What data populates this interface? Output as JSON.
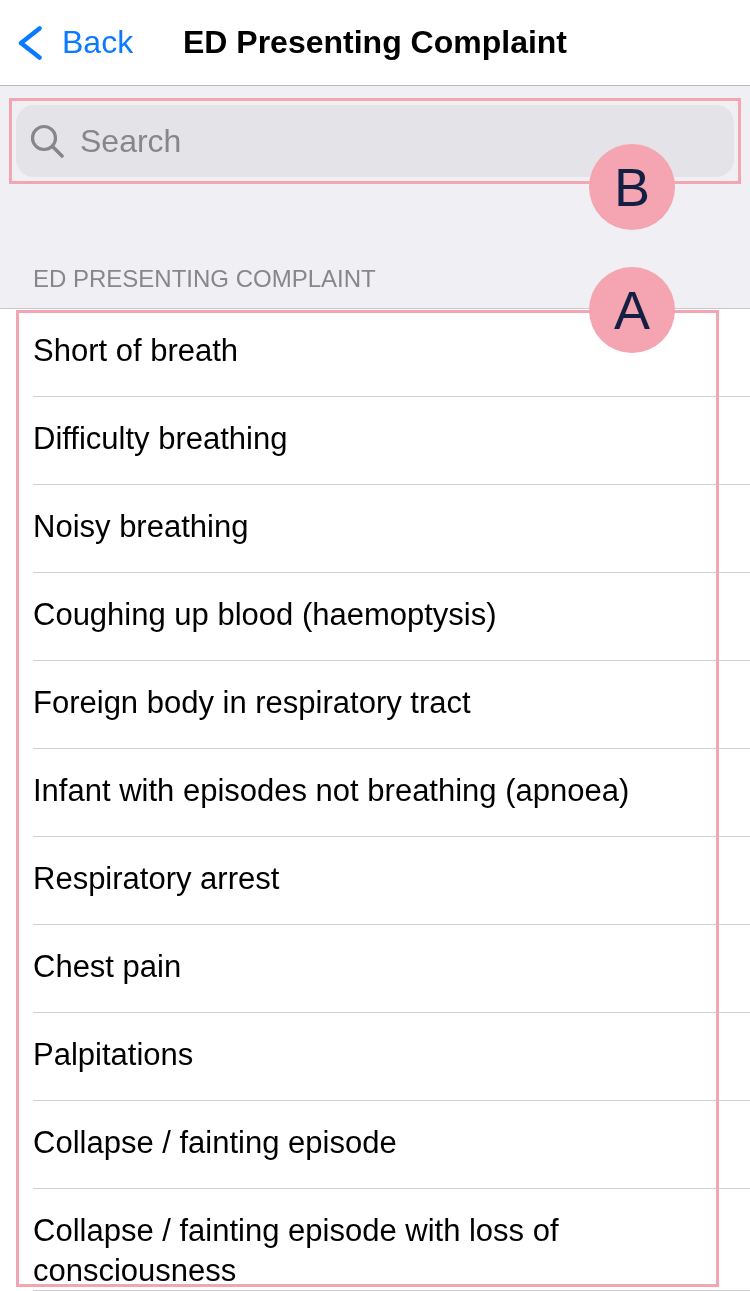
{
  "nav_bar": {
    "back_label": "Back",
    "title": "ED Presenting Complaint"
  },
  "search": {
    "placeholder": "Search",
    "annotation": "B"
  },
  "section": {
    "header": "ED PRESENTING COMPLAINT",
    "annotation": "A",
    "items": [
      "Short of breath",
      "Difficulty breathing",
      "Noisy breathing",
      "Coughing up blood (haemoptysis)",
      "Foreign body in respiratory tract",
      "Infant with episodes not breathing (apnoea)",
      "Respiratory arrest",
      "Chest pain",
      "Palpitations",
      "Collapse / fainting episode",
      "Collapse / fainting episode with loss of consciousness"
    ]
  }
}
